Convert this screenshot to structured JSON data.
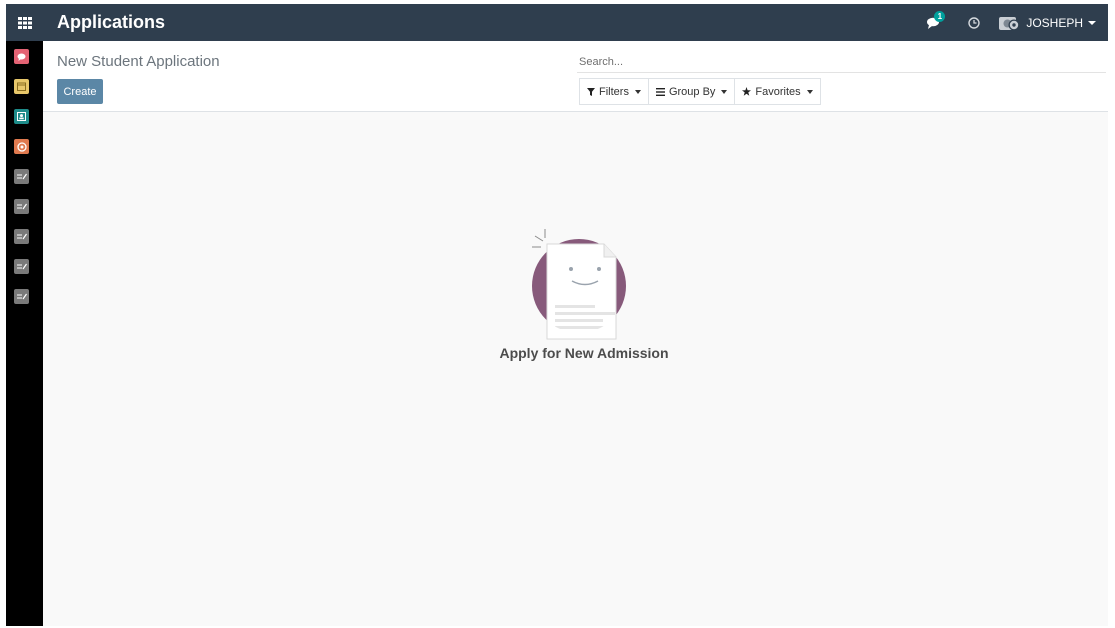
{
  "header": {
    "app_title": "Applications",
    "message_badge_count": "1",
    "user_name": "JOSHEPH",
    "icons": [
      "apps-grid-icon",
      "chat-icon",
      "clock-icon",
      "user-avatar-icon"
    ]
  },
  "sidebar": {
    "items": [
      {
        "name": "discuss",
        "color": "#e46374"
      },
      {
        "name": "calendar",
        "color": "#e8c76a"
      },
      {
        "name": "contacts",
        "color": "#1e8c8a"
      },
      {
        "name": "crm",
        "color": "#e07a4f"
      },
      {
        "name": "form",
        "color": "#7a7a7a"
      },
      {
        "name": "form",
        "color": "#7a7a7a"
      },
      {
        "name": "form",
        "color": "#7a7a7a"
      },
      {
        "name": "form",
        "color": "#7a7a7a"
      },
      {
        "name": "form",
        "color": "#7a7a7a"
      }
    ]
  },
  "control_panel": {
    "breadcrumb": "New Student Application",
    "create_label": "Create",
    "search_placeholder": "Search...",
    "filters_label": "Filters",
    "group_by_label": "Group By",
    "favorites_label": "Favorites"
  },
  "empty_state": {
    "message": "Apply for New Admission"
  },
  "colors": {
    "topbar": "#2f3e4e",
    "accent_button": "#5b87a6",
    "badge": "#00a09d",
    "illustration_circle": "#875a7b"
  }
}
